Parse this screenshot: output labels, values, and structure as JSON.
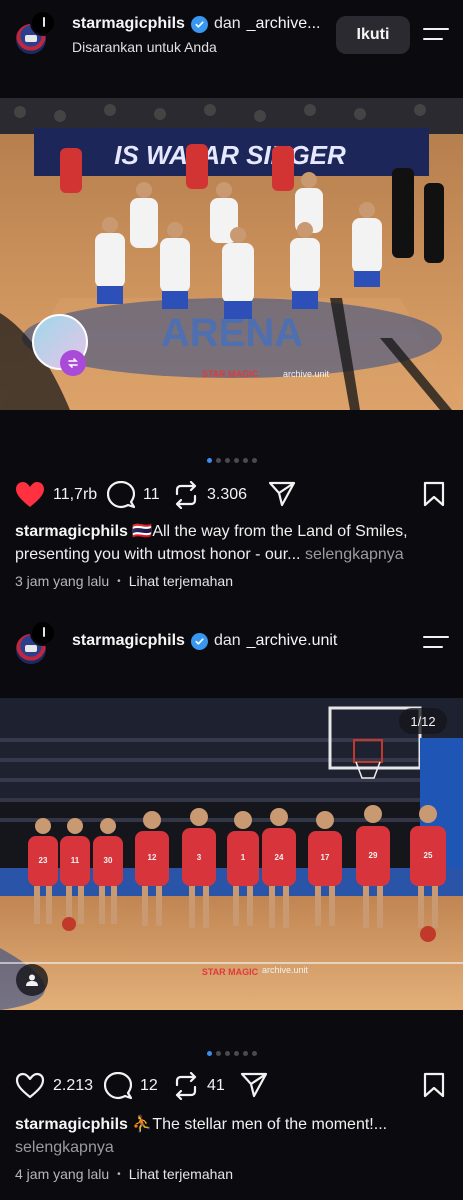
{
  "post1": {
    "username": "starmagicphils",
    "conj": "dan",
    "collaborator": "_archive...",
    "subtitle": "Disarankan untuk Anda",
    "follow_label": "Ikuti",
    "likes": "11,7rb",
    "comments": "11",
    "reposts": "3.306",
    "caption_user": "starmagicphils",
    "caption_text": "🇹🇭All the way from the Land of Smiles, presenting you with utmost honor - our...",
    "more_label": "selengkapnya",
    "time": "3 jam yang lalu",
    "translate_label": "Lihat terjemahan",
    "image_text": {
      "banner": "IS WAYAR SINGER",
      "court": "ARENA",
      "logo": "STAR MAGIC",
      "watermark": "archive.unit"
    },
    "liked": true
  },
  "post2": {
    "username": "starmagicphils",
    "conj": "dan",
    "collaborator": "_archive.unit",
    "likes": "2.213",
    "comments": "12",
    "reposts": "41",
    "counter": "1/12",
    "caption_user": "starmagicphils",
    "caption_text": "⛹️The stellar men of the moment!...",
    "more_label": "selengkapnya",
    "time": "4 jam yang lalu",
    "translate_label": "Lihat terjemahan",
    "image_text": {
      "logo": "STAR MAGIC",
      "watermark": "archive.unit",
      "numbers": [
        "23",
        "11",
        "30",
        "12",
        "3",
        "1",
        "24",
        "17",
        "29",
        "25"
      ]
    }
  },
  "colors": {
    "background": "#0b0b0f",
    "like_red": "#ff3040",
    "verified_blue": "#3897f0",
    "dot_active": "#3f8cf0"
  },
  "icons": [
    "verified-icon",
    "menu-icon",
    "heart-icon",
    "comment-icon",
    "repost-icon",
    "share-icon",
    "bookmark-icon",
    "user-tag-icon"
  ]
}
